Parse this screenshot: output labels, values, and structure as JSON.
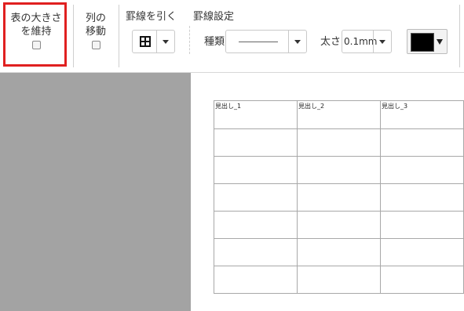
{
  "toolbar": {
    "keep_size": {
      "label_line1": "表の大きさ",
      "label_line2": "を維持",
      "checked": false
    },
    "move_column": {
      "label_line1": "列の",
      "label_line2": "移動",
      "checked": false
    },
    "draw_border": {
      "label": "罫線を引く",
      "icon": "border-all-icon"
    },
    "border_settings": {
      "label": "罫線設定",
      "type_label": "種類",
      "thickness_label": "太さ",
      "thickness_value": "0.1mm",
      "color": "#000000"
    }
  },
  "table": {
    "headers": [
      "見出し_1",
      "見出し_2",
      "見出し_3"
    ],
    "rows": [
      [
        "",
        "",
        ""
      ],
      [
        "",
        "",
        ""
      ],
      [
        "",
        "",
        ""
      ],
      [
        "",
        "",
        ""
      ],
      [
        "",
        "",
        ""
      ],
      [
        "",
        "",
        ""
      ]
    ]
  },
  "highlight_color": "#e02020"
}
